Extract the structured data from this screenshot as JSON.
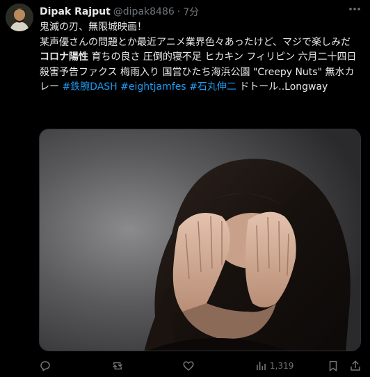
{
  "post": {
    "display_name": "Dipak Rajput",
    "handle": "@dipak8486",
    "separator": "·",
    "time": "7分",
    "body": {
      "line1": "鬼滅の刃、無限城映画！",
      "line2": "某声優さんの問題とか最近アニメ業界色々あったけど、マジで楽しみだ",
      "trend_bold": "コロナ陽性",
      "trends_plain": " 育ちの良さ 圧倒的寝不足 ヒカキン フィリピン 六月二十四日 殺害予告ファクス 梅雨入り 国営ひたち海浜公園 \"Creepy Nuts\" 無水カレー ",
      "hashtag1": "#鉄腕DASH",
      "hashtag2": "#eightjamfes",
      "hashtag3": "#石丸伸二",
      "tail": " ドトール..Longway"
    }
  },
  "actions": {
    "views": "1,319"
  },
  "icons": {
    "more": "more-dots-icon",
    "reply": "reply-icon",
    "repost": "repost-icon",
    "like": "heart-icon",
    "views": "views-chart-icon",
    "bookmark": "bookmark-icon",
    "share": "share-icon"
  },
  "colors": {
    "background": "#000000",
    "text": "#e7e9ea",
    "muted": "#71767b",
    "link": "#1d9bf0"
  }
}
